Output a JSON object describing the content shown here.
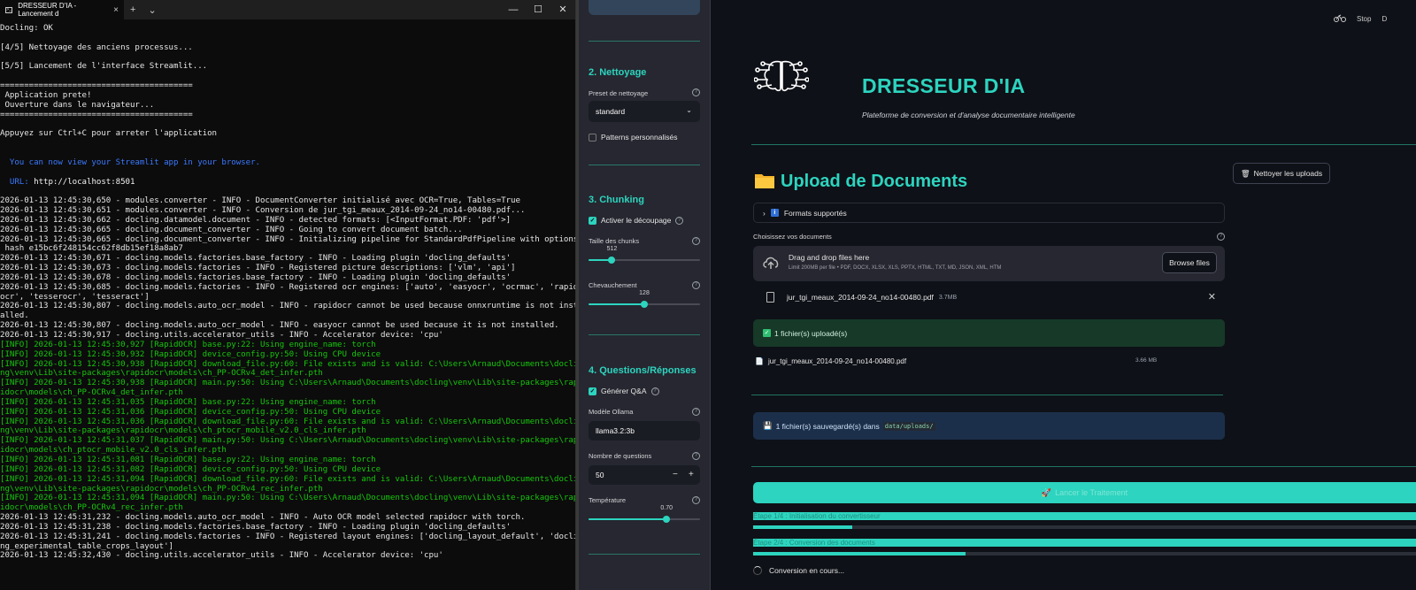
{
  "terminal": {
    "tab_title": "DRESSEUR D'IA - Lancement d",
    "new_tab": "+",
    "dropdown": "⌄",
    "lines": [
      {
        "t": "Docling: OK",
        "c": "w"
      },
      {
        "t": "",
        "c": "w"
      },
      {
        "t": "[4/5] Nettoyage des anciens processus...",
        "c": "w"
      },
      {
        "t": "",
        "c": "w"
      },
      {
        "t": "[5/5] Lancement de l'interface Streamlit...",
        "c": "w"
      },
      {
        "t": "",
        "c": "w"
      },
      {
        "t": "========================================",
        "c": "w"
      },
      {
        "t": " Application prete!",
        "c": "w"
      },
      {
        "t": " Ouverture dans le navigateur...",
        "c": "w"
      },
      {
        "t": "========================================",
        "c": "w"
      },
      {
        "t": "",
        "c": "w"
      },
      {
        "t": "Appuyez sur Ctrl+C pour arreter l'application",
        "c": "w"
      },
      {
        "t": "",
        "c": "w"
      },
      {
        "t": "",
        "c": "w"
      },
      {
        "t": "  You can now view your Streamlit app in your browser.",
        "c": "blue"
      },
      {
        "t": "",
        "c": "w"
      },
      {
        "t": "  URL: http://localhost:8501",
        "c": "url"
      },
      {
        "t": "",
        "c": "w"
      },
      {
        "t": "2026-01-13 12:45:30,650 - modules.converter - INFO - DocumentConverter initialisé avec OCR=True, Tables=True",
        "c": "w"
      },
      {
        "t": "2026-01-13 12:45:30,651 - modules.converter - INFO - Conversion de jur_tgi_meaux_2014-09-24_no14-00480.pdf...",
        "c": "w"
      },
      {
        "t": "2026-01-13 12:45:30,662 - docling.datamodel.document - INFO - detected formats: [<InputFormat.PDF: 'pdf'>]",
        "c": "w"
      },
      {
        "t": "2026-01-13 12:45:30,665 - docling.document_converter - INFO - Going to convert document batch...",
        "c": "w"
      },
      {
        "t": "2026-01-13 12:45:30,665 - docling.document_converter - INFO - Initializing pipeline for StandardPdfPipeline with options",
        "c": "w"
      },
      {
        "t": " hash e15bc6f248154cc62f8db15ef18a8ab7",
        "c": "w"
      },
      {
        "t": "2026-01-13 12:45:30,671 - docling.models.factories.base_factory - INFO - Loading plugin 'docling_defaults'",
        "c": "w"
      },
      {
        "t": "2026-01-13 12:45:30,673 - docling.models.factories - INFO - Registered picture descriptions: ['vlm', 'api']",
        "c": "w"
      },
      {
        "t": "2026-01-13 12:45:30,678 - docling.models.factories.base_factory - INFO - Loading plugin 'docling_defaults'",
        "c": "w"
      },
      {
        "t": "2026-01-13 12:45:30,685 - docling.models.factories - INFO - Registered ocr engines: ['auto', 'easyocr', 'ocrmac', 'rapid",
        "c": "w"
      },
      {
        "t": "ocr', 'tesserocr', 'tesseract']",
        "c": "w"
      },
      {
        "t": "2026-01-13 12:45:30,807 - docling.models.auto_ocr_model - INFO - rapidocr cannot be used because onnxruntime is not inst",
        "c": "w"
      },
      {
        "t": "alled.",
        "c": "w"
      },
      {
        "t": "2026-01-13 12:45:30,807 - docling.models.auto_ocr_model - INFO - easyocr cannot be used because it is not installed.",
        "c": "w"
      },
      {
        "t": "2026-01-13 12:45:30,917 - docling.utils.accelerator_utils - INFO - Accelerator device: 'cpu'",
        "c": "w"
      },
      {
        "t": "[INFO] 2026-01-13 12:45:30,927 [RapidOCR] base.py:22: Using engine_name: torch",
        "c": "green"
      },
      {
        "t": "[INFO] 2026-01-13 12:45:30,932 [RapidOCR] device_config.py:50: Using CPU device",
        "c": "green"
      },
      {
        "t": "[INFO] 2026-01-13 12:45:30,938 [RapidOCR] download_file.py:60: File exists and is valid: C:\\Users\\Arnaud\\Documents\\docli",
        "c": "green"
      },
      {
        "t": "ng\\venv\\Lib\\site-packages\\rapidocr\\models\\ch_PP-OCRv4_det_infer.pth",
        "c": "green"
      },
      {
        "t": "[INFO] 2026-01-13 12:45:30,938 [RapidOCR] main.py:50: Using C:\\Users\\Arnaud\\Documents\\docling\\venv\\Lib\\site-packages\\rap",
        "c": "green"
      },
      {
        "t": "idocr\\models\\ch_PP-OCRv4_det_infer.pth",
        "c": "green"
      },
      {
        "t": "[INFO] 2026-01-13 12:45:31,035 [RapidOCR] base.py:22: Using engine_name: torch",
        "c": "green"
      },
      {
        "t": "[INFO] 2026-01-13 12:45:31,036 [RapidOCR] device_config.py:50: Using CPU device",
        "c": "green"
      },
      {
        "t": "[INFO] 2026-01-13 12:45:31,036 [RapidOCR] download_file.py:60: File exists and is valid: C:\\Users\\Arnaud\\Documents\\docli",
        "c": "green"
      },
      {
        "t": "ng\\venv\\Lib\\site-packages\\rapidocr\\models\\ch_ptocr_mobile_v2.0_cls_infer.pth",
        "c": "green"
      },
      {
        "t": "[INFO] 2026-01-13 12:45:31,037 [RapidOCR] main.py:50: Using C:\\Users\\Arnaud\\Documents\\docling\\venv\\Lib\\site-packages\\rap",
        "c": "green"
      },
      {
        "t": "idocr\\models\\ch_ptocr_mobile_v2.0_cls_infer.pth",
        "c": "green"
      },
      {
        "t": "[INFO] 2026-01-13 12:45:31,081 [RapidOCR] base.py:22: Using engine_name: torch",
        "c": "green"
      },
      {
        "t": "[INFO] 2026-01-13 12:45:31,082 [RapidOCR] device_config.py:50: Using CPU device",
        "c": "green"
      },
      {
        "t": "[INFO] 2026-01-13 12:45:31,094 [RapidOCR] download_file.py:60: File exists and is valid: C:\\Users\\Arnaud\\Documents\\docli",
        "c": "green"
      },
      {
        "t": "ng\\venv\\Lib\\site-packages\\rapidocr\\models\\ch_PP-OCRv4_rec_infer.pth",
        "c": "green"
      },
      {
        "t": "[INFO] 2026-01-13 12:45:31,094 [RapidOCR] main.py:50: Using C:\\Users\\Arnaud\\Documents\\docling\\venv\\Lib\\site-packages\\rap",
        "c": "green"
      },
      {
        "t": "idocr\\models\\ch_PP-OCRv4_rec_infer.pth",
        "c": "green"
      },
      {
        "t": "2026-01-13 12:45:31,232 - docling.models.auto_ocr_model - INFO - Auto OCR model selected rapidocr with torch.",
        "c": "w"
      },
      {
        "t": "2026-01-13 12:45:31,238 - docling.models.factories.base_factory - INFO - Loading plugin 'docling_defaults'",
        "c": "w"
      },
      {
        "t": "2026-01-13 12:45:31,241 - docling.models.factories - INFO - Registered layout engines: ['docling_layout_default', 'docli",
        "c": "w"
      },
      {
        "t": "ng_experimental_table_crops_layout']",
        "c": "w"
      },
      {
        "t": "2026-01-13 12:45:32,430 - docling.utils.accelerator_utils - INFO - Accelerator device: 'cpu'",
        "c": "w"
      }
    ],
    "url_label": "URL:",
    "url_value": "http://localhost:8501"
  },
  "sidebar": {
    "section_cleaning": "2. Nettoyage",
    "preset_label": "Preset de nettoyage",
    "preset_value": "standard",
    "custom_patterns": "Patterns personnalisés",
    "section_chunking": "3. Chunking",
    "enable_chunking": "Activer le découpage",
    "chunk_size_label": "Taille des chunks",
    "chunk_size_value": "512",
    "chunk_size_frac": 0.21,
    "overlap_label": "Chevauchement",
    "overlap_value": "128",
    "overlap_frac": 0.5,
    "section_qa": "4. Questions/Réponses",
    "generate_qa": "Générer Q&A",
    "model_label": "Modèle Ollama",
    "model_value": "llama3.2:3b",
    "questions_label": "Nombre de questions",
    "questions_value": "50",
    "temperature_label": "Température",
    "temperature_value": "0.70",
    "temperature_frac": 0.7
  },
  "main": {
    "stop_label": "Stop",
    "deploy_label": "D",
    "title": "DRESSEUR D'IA",
    "subtitle": "Plateforme de conversion et d'analyse documentaire intelligente",
    "clean_uploads": "Nettoyer les uploads",
    "upload_title": "Upload de Documents",
    "formats_expander": "Formats supportés",
    "choose_docs": "Choisissez vos documents",
    "drop_main": "Drag and drop files here",
    "drop_sub": "Limit 200MB per file • PDF, DOCX, XLSX, XLS, PPTX, HTML, TXT, MD, JSON, XML, HTM",
    "browse": "Browse files",
    "file_name": "jur_tgi_meaux_2014-09-24_no14-00480.pdf",
    "file_size": "3.7MB",
    "uploaded_msg": "1 fichier(s) uploadé(s)",
    "saved_file_name": "jur_tgi_meaux_2014-09-24_no14-00480.pdf",
    "saved_file_size": "3.66 MB",
    "saved_msg": "1 fichier(s) sauvegardé(s) dans",
    "saved_path": "data/uploads/",
    "run_button": "Lancer le Traitement",
    "step1": "Étape 1/4 : Initialisation du convertisseur",
    "step1_progress": 0.15,
    "step2": "Étape 2/4 : Conversion des documents",
    "step2_progress": 0.32,
    "converting": "Conversion en cours..."
  },
  "colors": {
    "accent": "#2dd4bf",
    "sidebar_bg": "#262730",
    "main_bg": "#0e1117",
    "terminal_bg": "#0c0c0c",
    "log_green": "#16c60c"
  }
}
